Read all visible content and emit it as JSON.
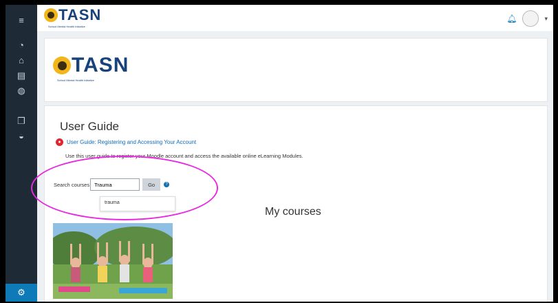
{
  "header": {
    "logo_text": "TASN",
    "logo_tagline": "School Mental Health Initiative"
  },
  "banner": {
    "logo_text": "TASN",
    "logo_tagline": "School Mental Health Initiative"
  },
  "guide": {
    "title": "User Guide",
    "link_text": "User Guide: Registering and Accessing Your Account",
    "description": "Use this user guide to register your Moodle account and access the available online eLearning Modules."
  },
  "search": {
    "label": "Search courses",
    "value": "Trauma",
    "go_label": "Go",
    "suggestion": "trauma"
  },
  "courses": {
    "heading": "My courses"
  },
  "colors": {
    "sidebar": "#1e2a36",
    "accent": "#0f7ab8",
    "highlight_circle": "#e829e0",
    "logo_blue": "#17427a",
    "sun_yellow": "#f2b61b"
  },
  "icons": {
    "sidebar": [
      "menu-icon",
      "dashboard-icon",
      "home-icon",
      "calendar-icon",
      "files-icon",
      "courses-icon",
      "graduation-icon"
    ],
    "topbar": [
      "bell-icon",
      "avatar",
      "chevron-down-icon"
    ]
  }
}
